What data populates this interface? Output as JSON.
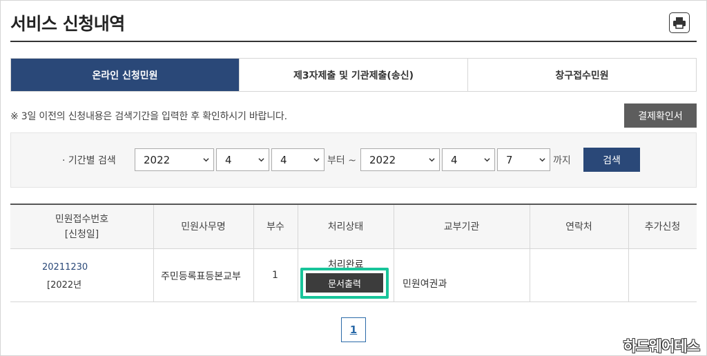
{
  "page": {
    "title": "서비스 신청내역"
  },
  "tabs": [
    {
      "label": "온라인 신청민원",
      "active": true
    },
    {
      "label": "제3자제출 및 기관제출(송신)",
      "active": false
    },
    {
      "label": "창구접수민원",
      "active": false
    }
  ],
  "notice": "※ 3일 이전의 신청내용은 검색기간을 입력한 후 확인하시기 바랍니다.",
  "confirm_button": "결제확인서",
  "search": {
    "label": "· 기간별 검색",
    "from": {
      "year": "2022",
      "month": "4",
      "day": "4"
    },
    "from_suffix": "부터 ~",
    "to": {
      "year": "2022",
      "month": "4",
      "day": "7"
    },
    "to_suffix": "까지",
    "button": "검색"
  },
  "table": {
    "headers": {
      "receipt_no": "민원접수번호",
      "apply_date": "[신청일]",
      "office": "민원사무명",
      "copies": "부수",
      "status": "처리상태",
      "issuer": "교부기관",
      "contact": "연락처",
      "additional": "추가신청"
    },
    "row": {
      "receipt_no": "20211230",
      "apply_date": "[2022년",
      "office": "주민등록표등본교부",
      "copies": "1",
      "status": "처리완료",
      "print_button": "문서출력",
      "issuer": "민원여권과",
      "contact": "",
      "additional": ""
    }
  },
  "pagination": {
    "current": "1"
  },
  "watermark": "하드웨어테스",
  "colors": {
    "accent": "#2a4878",
    "highlight": "#18c49a",
    "dark_button": "#5d5d5d"
  }
}
